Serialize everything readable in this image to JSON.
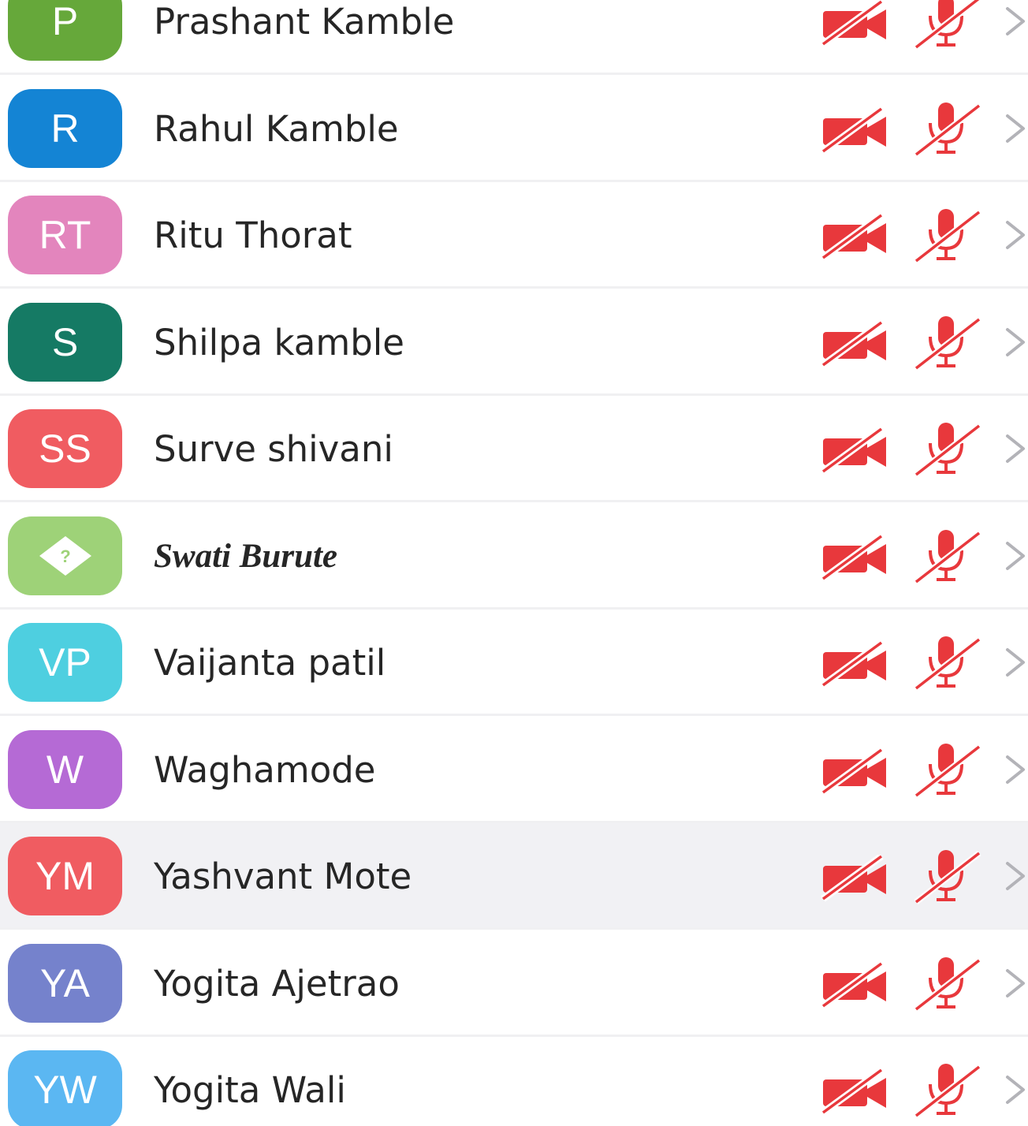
{
  "participants": [
    {
      "initials": "P",
      "name": "Prashant Kamble",
      "avatar_color": "#66a83a",
      "video_muted": true,
      "audio_muted": true
    },
    {
      "initials": "R",
      "name": "Rahul Kamble",
      "avatar_color": "#1484d4",
      "video_muted": true,
      "audio_muted": true
    },
    {
      "initials": "RT",
      "name": "Ritu Thorat",
      "avatar_color": "#e385bd",
      "video_muted": true,
      "audio_muted": true
    },
    {
      "initials": "S",
      "name": "Shilpa kamble",
      "avatar_color": "#157a64",
      "video_muted": true,
      "audio_muted": true
    },
    {
      "initials": "SS",
      "name": "Surve shivani",
      "avatar_color": "#f05c61",
      "video_muted": true,
      "audio_muted": true
    },
    {
      "initials": "",
      "name": "Swati Burute",
      "avatar_color": "#9ed278",
      "avatar_icon": "question-diamond-icon",
      "name_style": "italic",
      "video_muted": true,
      "audio_muted": true
    },
    {
      "initials": "VP",
      "name": "Vaijanta patil",
      "avatar_color": "#4ecfe0",
      "video_muted": true,
      "audio_muted": true
    },
    {
      "initials": "W",
      "name": "Waghamode",
      "avatar_color": "#b56ad5",
      "video_muted": true,
      "audio_muted": true
    },
    {
      "initials": "YM",
      "name": "Yashvant Mote",
      "avatar_color": "#f05c61",
      "video_muted": true,
      "audio_muted": true,
      "highlighted": true
    },
    {
      "initials": "YA",
      "name": "Yogita Ajetrao",
      "avatar_color": "#7582cc",
      "video_muted": true,
      "audio_muted": true
    },
    {
      "initials": "YW",
      "name": "Yogita Wali",
      "avatar_color": "#5bb7f2",
      "video_muted": true,
      "audio_muted": true
    }
  ],
  "icons": {
    "video": "video-off-icon",
    "mic": "mic-off-icon",
    "chevron": "chevron-right-icon"
  },
  "colors": {
    "muted_icon": "#e8383c",
    "chevron": "#b3b3b8",
    "divider": "#f0f0f2",
    "highlight_row": "#f1f1f4",
    "name_text": "#262626"
  }
}
